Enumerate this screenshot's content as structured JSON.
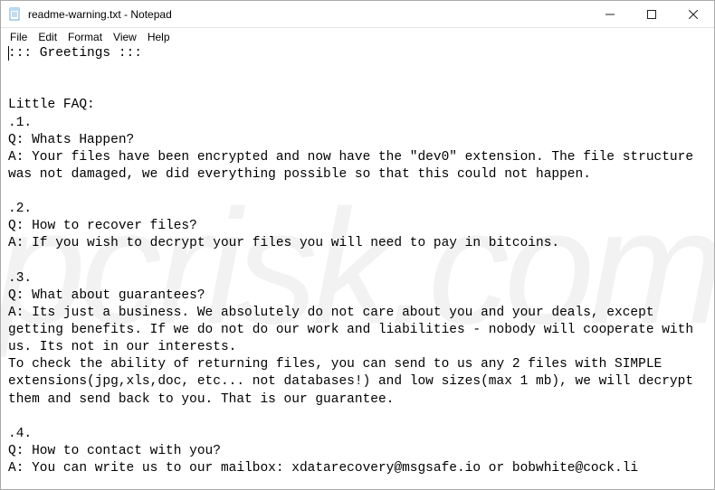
{
  "window": {
    "title": "readme-warning.txt - Notepad"
  },
  "menu": {
    "file": "File",
    "edit": "Edit",
    "format": "Format",
    "view": "View",
    "help": "Help"
  },
  "content": {
    "text": "::: Greetings :::\n\n\nLittle FAQ:\n.1.\nQ: Whats Happen?\nA: Your files have been encrypted and now have the \"dev0\" extension. The file structure was not damaged, we did everything possible so that this could not happen.\n\n.2.\nQ: How to recover files?\nA: If you wish to decrypt your files you will need to pay in bitcoins.\n\n.3.\nQ: What about guarantees?\nA: Its just a business. We absolutely do not care about you and your deals, except getting benefits. If we do not do our work and liabilities - nobody will cooperate with us. Its not in our interests.\nTo check the ability of returning files, you can send to us any 2 files with SIMPLE extensions(jpg,xls,doc, etc... not databases!) and low sizes(max 1 mb), we will decrypt them and send back to you. That is our guarantee.\n\n.4.\nQ: How to contact with you?\nA: You can write us to our mailbox: xdatarecovery@msgsafe.io or bobwhite@cock.li"
  },
  "watermark": {
    "text": "pcrisk.com"
  }
}
